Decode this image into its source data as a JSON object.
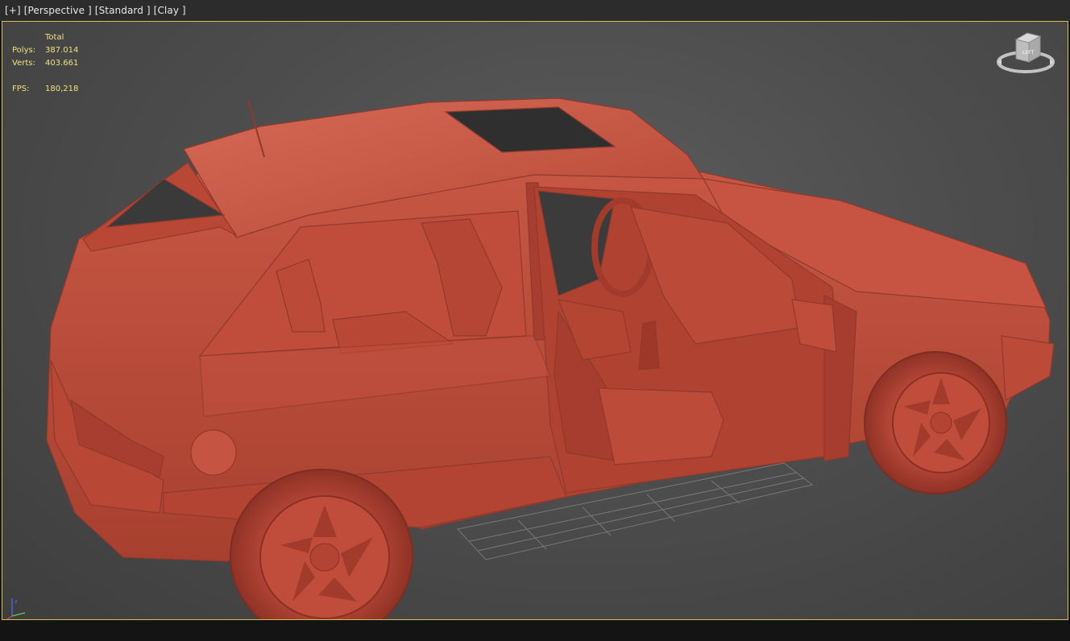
{
  "viewport": {
    "labels": [
      "[+]",
      "[Perspective ]",
      "[Standard ]",
      "[Clay ]"
    ],
    "stats": {
      "header": "Total",
      "polys_label": "Polys:",
      "polys_value": "387.014",
      "verts_label": "Verts:",
      "verts_value": "403.661",
      "fps_label": "FPS:",
      "fps_value": "180,218"
    },
    "viewcube": {
      "face_label": "LEFT"
    },
    "colors": {
      "clay": "#c3503f",
      "border_active": "#d3c052",
      "stats_text": "#f0e07a",
      "background": "#4d4d4d"
    }
  }
}
